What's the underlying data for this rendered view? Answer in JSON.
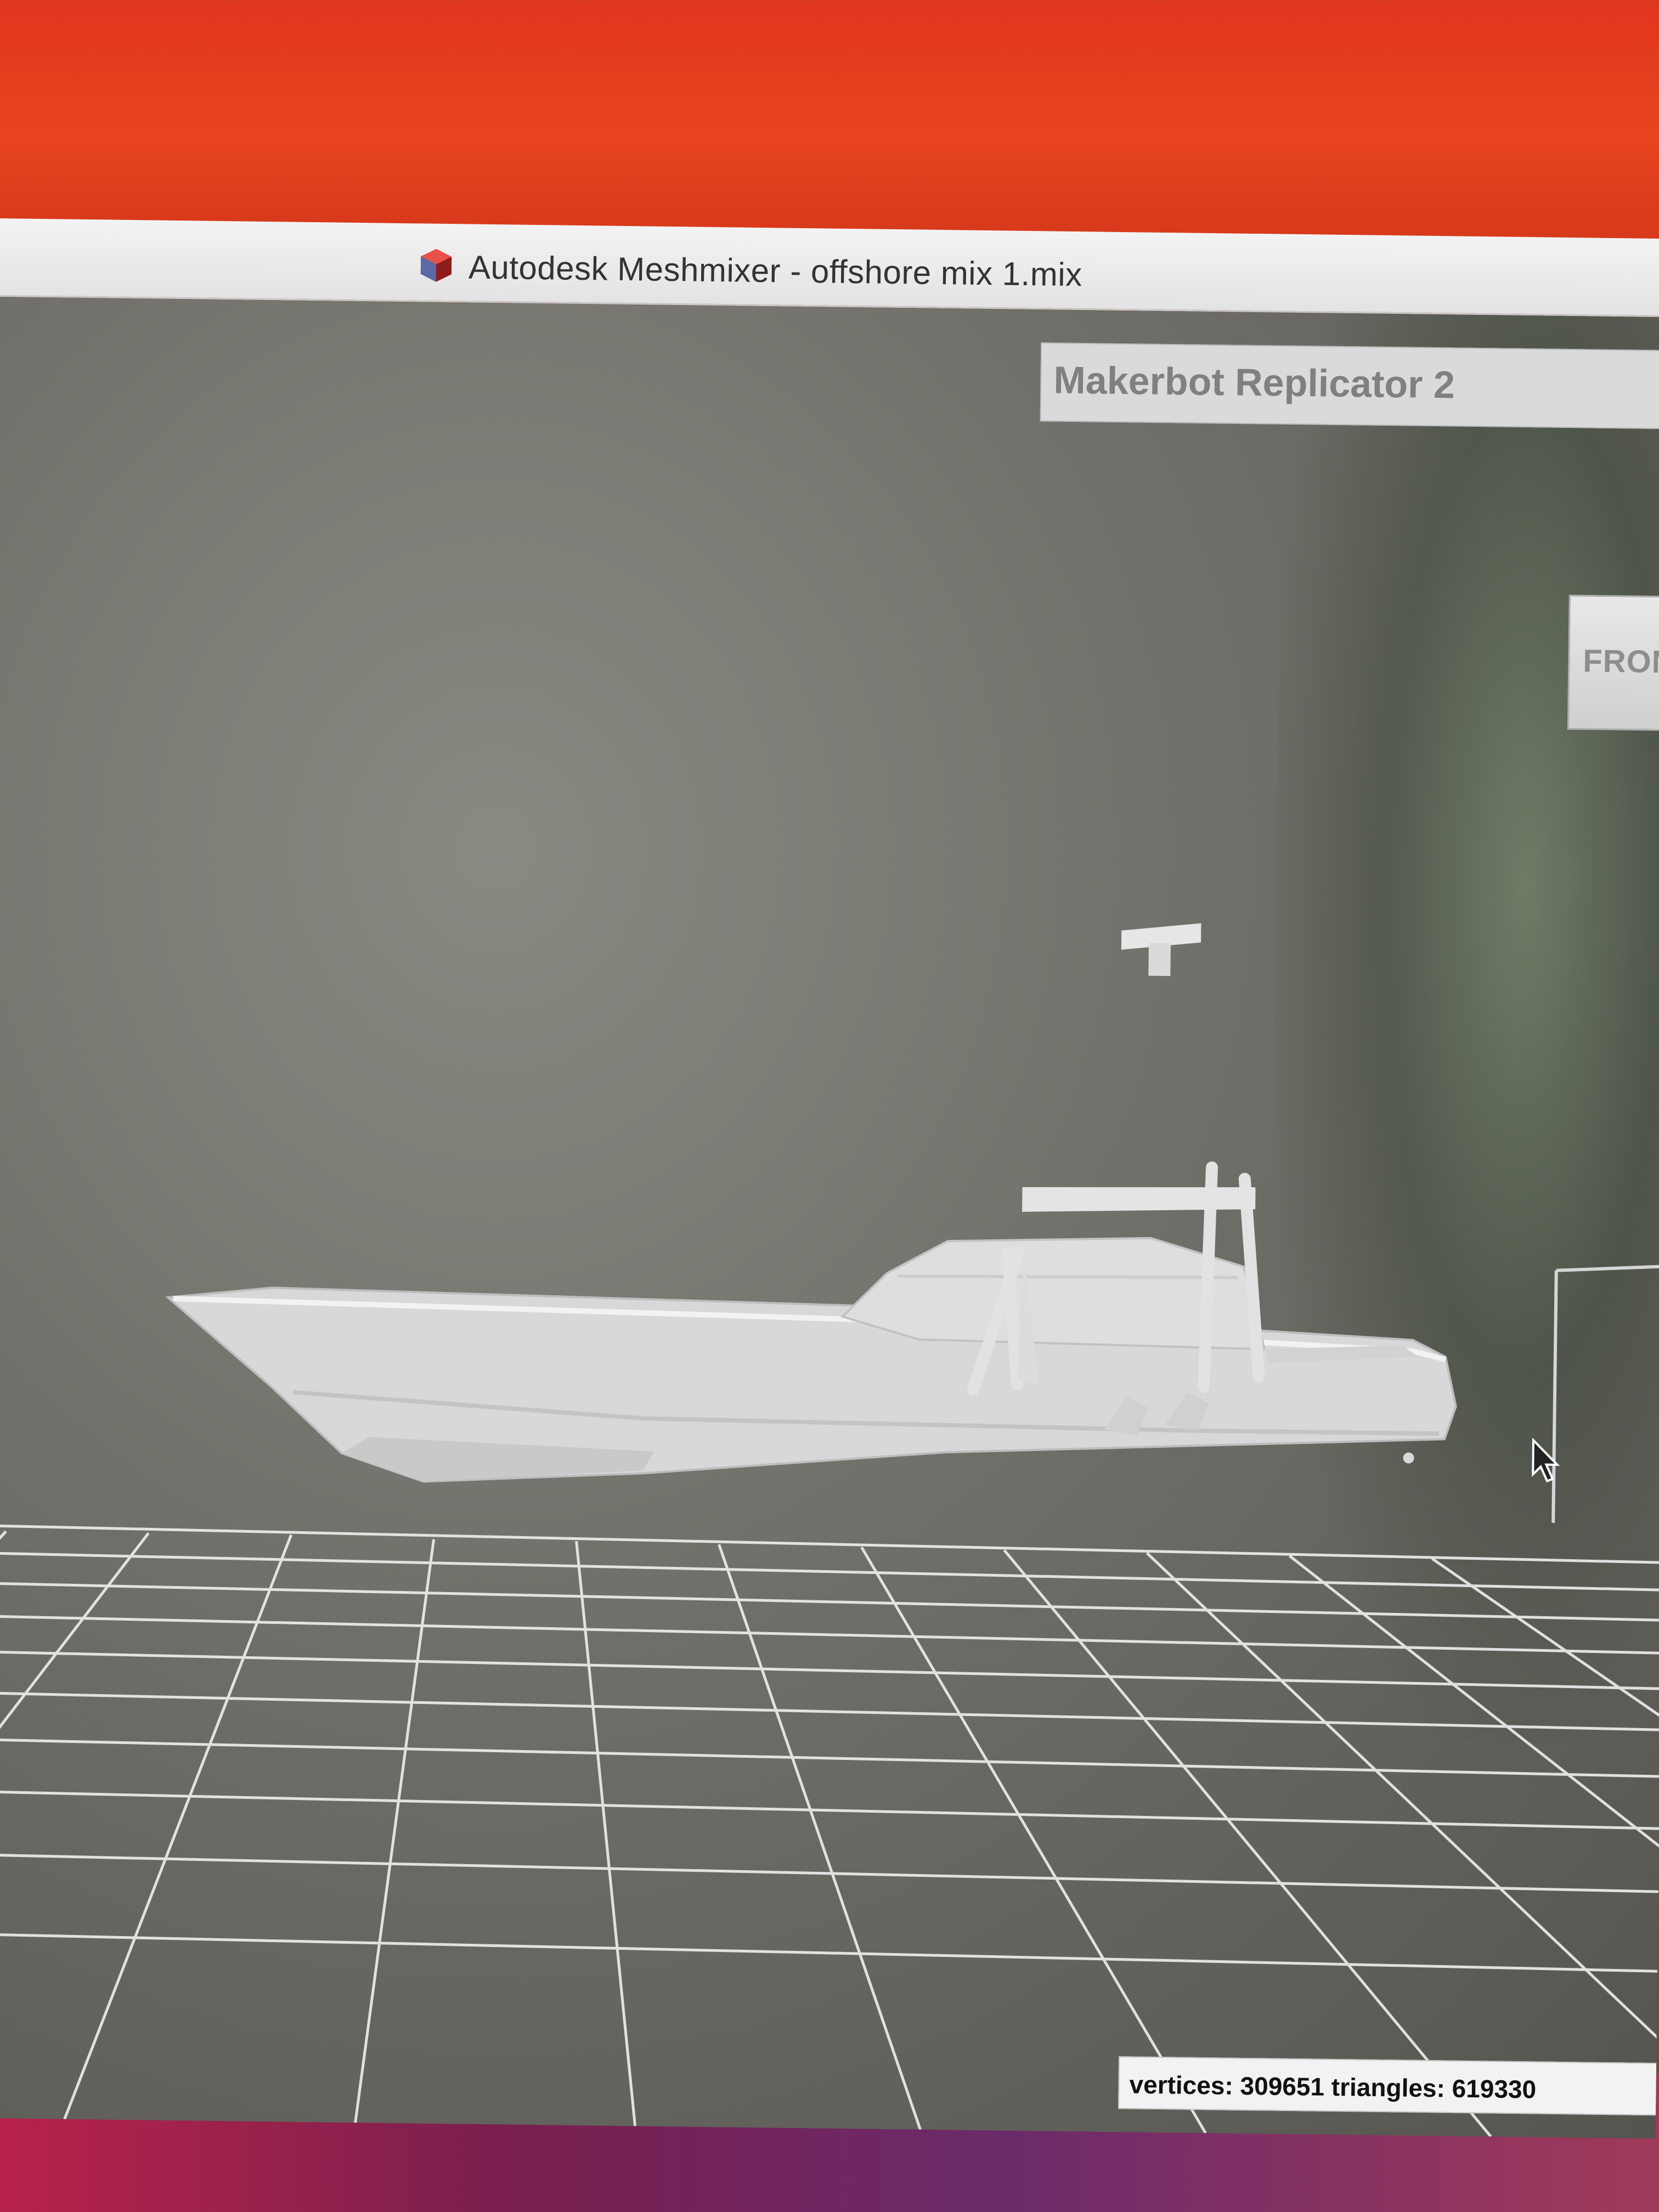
{
  "window": {
    "title": "Autodesk Meshmixer - offshore mix 1.mix",
    "app_icon": "meshmixer-logo-icon"
  },
  "viewport": {
    "printer_name": "Makerbot Replicator 2",
    "viewcube_label": "FRON",
    "stats": "vertices: 309651 triangles: 619330",
    "model": "offshore boat mesh",
    "grid": true
  },
  "colors": {
    "viewport_bg": "#6f6e68",
    "grid_line": "#ededed",
    "model": "#dcdcdc",
    "titlebar": "#ececec"
  }
}
